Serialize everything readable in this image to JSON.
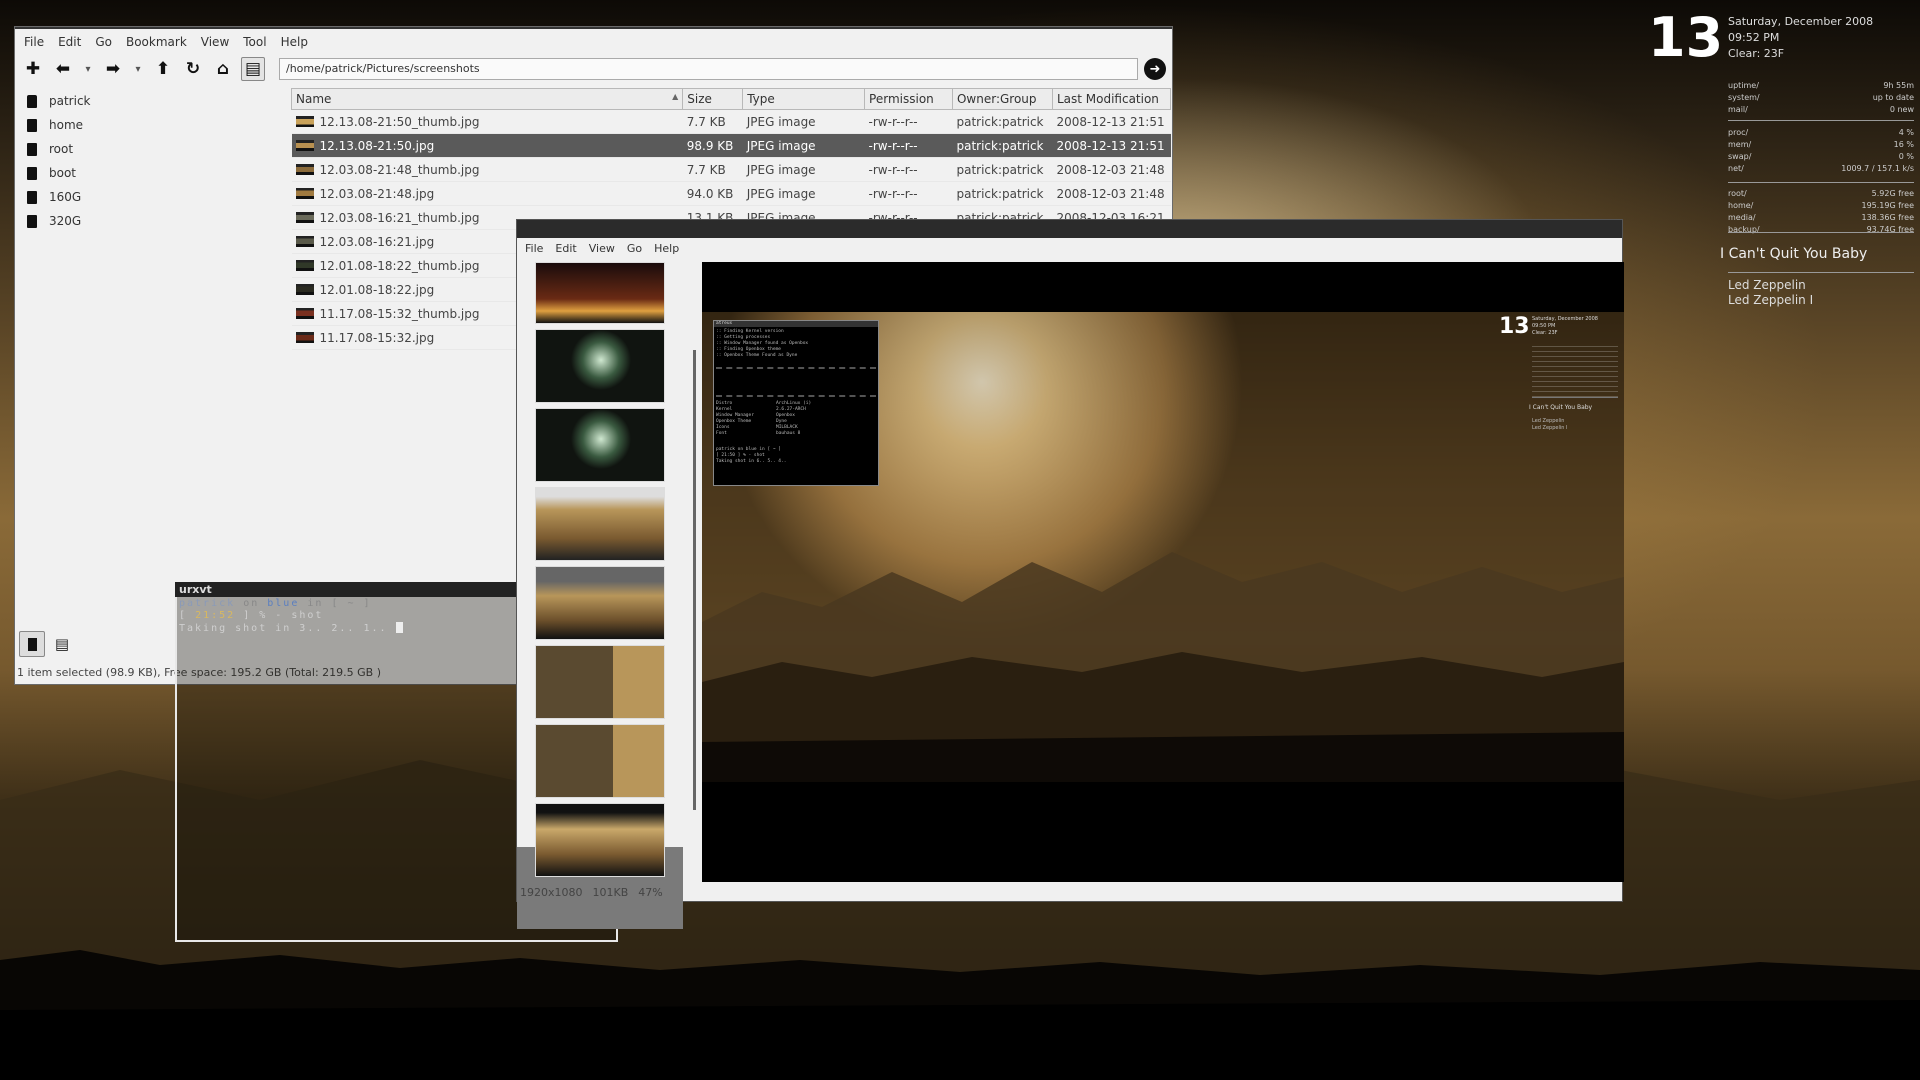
{
  "file_manager": {
    "menu": [
      "File",
      "Edit",
      "Go",
      "Bookmark",
      "View",
      "Tool",
      "Help"
    ],
    "address": "/home/patrick/Pictures/screenshots",
    "sidebar": [
      {
        "label": "patrick"
      },
      {
        "label": "home"
      },
      {
        "label": "root"
      },
      {
        "label": "boot"
      },
      {
        "label": "160G"
      },
      {
        "label": "320G"
      }
    ],
    "columns": [
      "Name",
      "Size",
      "Type",
      "Permission",
      "Owner:Group",
      "Last Modification"
    ],
    "rows": [
      {
        "name": "12.13.08-21:50_thumb.jpg",
        "size": "7.7 KB",
        "type": "JPEG image",
        "perm": "-rw-r--r--",
        "owner": "patrick:patrick",
        "modified": "2008-12-13 21:51",
        "selected": false
      },
      {
        "name": "12.13.08-21:50.jpg",
        "size": "98.9 KB",
        "type": "JPEG image",
        "perm": "-rw-r--r--",
        "owner": "patrick:patrick",
        "modified": "2008-12-13 21:51",
        "selected": true
      },
      {
        "name": "12.03.08-21:48_thumb.jpg",
        "size": "7.7 KB",
        "type": "JPEG image",
        "perm": "-rw-r--r--",
        "owner": "patrick:patrick",
        "modified": "2008-12-03 21:48",
        "selected": false
      },
      {
        "name": "12.03.08-21:48.jpg",
        "size": "94.0 KB",
        "type": "JPEG image",
        "perm": "-rw-r--r--",
        "owner": "patrick:patrick",
        "modified": "2008-12-03 21:48",
        "selected": false
      },
      {
        "name": "12.03.08-16:21_thumb.jpg",
        "size": "13.1 KB",
        "type": "JPEG image",
        "perm": "-rw-r--r--",
        "owner": "patrick:patrick",
        "modified": "2008-12-03 16:21",
        "selected": false
      },
      {
        "name": "12.03.08-16:21.jpg",
        "size": "",
        "type": "",
        "perm": "",
        "owner": "",
        "modified": "",
        "selected": false
      },
      {
        "name": "12.01.08-18:22_thumb.jpg",
        "size": "",
        "type": "",
        "perm": "",
        "owner": "",
        "modified": "",
        "selected": false
      },
      {
        "name": "12.01.08-18:22.jpg",
        "size": "",
        "type": "",
        "perm": "",
        "owner": "",
        "modified": "",
        "selected": false
      },
      {
        "name": "11.17.08-15:32_thumb.jpg",
        "size": "",
        "type": "",
        "perm": "",
        "owner": "",
        "modified": "",
        "selected": false
      },
      {
        "name": "11.17.08-15:32.jpg",
        "size": "",
        "type": "",
        "perm": "",
        "owner": "",
        "modified": "",
        "selected": false
      }
    ],
    "status": "1 item selected (98.9 KB), Free space: 195.2 GB (Total: 219.5 GB )"
  },
  "terminal": {
    "title": "urxvt",
    "line1_user": "patrick",
    "line1_on": "on",
    "line1_host": "blue",
    "line1_rest": "in [ ~ ]",
    "line2_open": "[",
    "line2_time": "21:52",
    "line2_rest": "] % - shot",
    "line3": "Taking shot in 3.. 2.. 1.."
  },
  "viewer": {
    "menu": [
      "File",
      "Edit",
      "View",
      "Go",
      "Help"
    ],
    "status": {
      "resolution": "1920x1080",
      "size": "101KB",
      "zoom": "47%"
    },
    "preview_conky": {
      "day": "13",
      "date": "Saturday, December 2008",
      "time": "09:50 PM",
      "weather": "Clear: 23F",
      "song": "I Can't Quit You Baby",
      "artist": "Led Zeppelin",
      "album": "Led Zeppelin I"
    },
    "preview_terminal": {
      "title": "atreus",
      "lines": [
        ":: Finding Kernel version",
        ":: Getting processes",
        ":: Window Manager found as Openbox",
        ":: Finding Openbox theme",
        ":: Openbox Theme Found as Dyne"
      ],
      "info": [
        [
          "Distro",
          "ArchLinux (i)"
        ],
        [
          "Kernel",
          "2.6.27-ARCH"
        ],
        [
          "Window Manager",
          "Openbox"
        ],
        [
          "Openbox Theme",
          "Dyne"
        ],
        [
          "Icons",
          "MILBLACK"
        ],
        [
          "Font",
          "bauhaus 8"
        ]
      ],
      "prompt": "patrick on blue in [ ~ ]",
      "prompt2": "[ 21:50 ] % - shot",
      "countdown": "Taking shot in 6.. 5.. 4.."
    }
  },
  "conky": {
    "day": "13",
    "date": "Saturday, December 2008",
    "time": "09:52 PM",
    "weather": "Clear: 23F",
    "system": [
      {
        "label": "uptime/",
        "value": "9h 55m"
      },
      {
        "label": "system/",
        "value": "up to date"
      },
      {
        "label": "mail/",
        "value": "0 new"
      }
    ],
    "resources": [
      {
        "label": "proc/",
        "value": "4 %"
      },
      {
        "label": "mem/",
        "value": "16 %"
      },
      {
        "label": "swap/",
        "value": "0 %"
      },
      {
        "label": "net/",
        "value": "1009.7 / 157.1 k/s"
      }
    ],
    "disks": [
      {
        "label": "root/",
        "value": "5.92G free"
      },
      {
        "label": "home/",
        "value": "195.19G free"
      },
      {
        "label": "media/",
        "value": "138.36G free"
      },
      {
        "label": "backup/",
        "value": "93.74G free"
      }
    ],
    "song": "I Can't Quit You Baby",
    "artist": "Led Zeppelin",
    "album": "Led Zeppelin I"
  }
}
